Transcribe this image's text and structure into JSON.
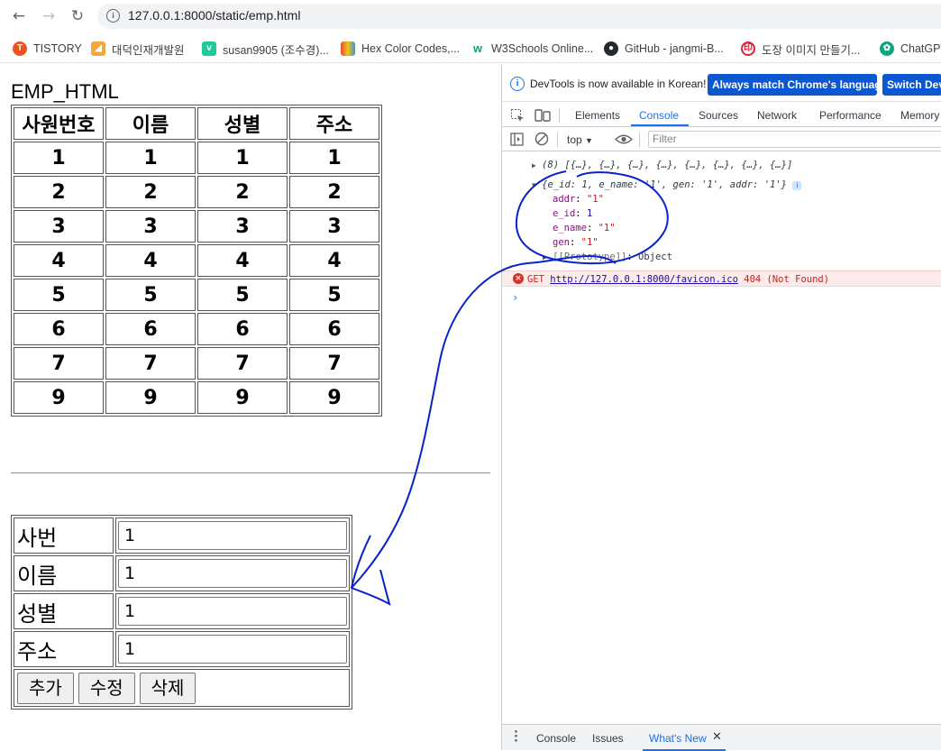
{
  "browser": {
    "url": "127.0.0.1:8000/static/emp.html",
    "nav": {
      "back": "←",
      "forward": "→",
      "reload": "↻"
    },
    "bookmarks": [
      {
        "label": "TISTORY",
        "icon": "tistory-icon",
        "color": "#eb531f"
      },
      {
        "label": "대덕인재개발원",
        "icon": "ddit-icon",
        "color": "#f4a83a"
      },
      {
        "label": "susan9905 (조수경)...",
        "icon": "velog-icon",
        "color": "#20c997"
      },
      {
        "label": "Hex Color Codes,...",
        "icon": "hexcolor-icon",
        "color": "#5b6ee1"
      },
      {
        "label": "W3Schools Online...",
        "icon": "w3schools-icon",
        "color": "#04aa6d"
      },
      {
        "label": "GitHub - jangmi-B...",
        "icon": "github-icon",
        "color": "#24292f"
      },
      {
        "label": "도장 이미지 만들기...",
        "icon": "stamp-icon",
        "color": "#d7263d"
      },
      {
        "label": "ChatGPT",
        "icon": "chatgpt-icon",
        "color": "#10a37f"
      }
    ]
  },
  "page": {
    "title": "EMP_HTML",
    "table": {
      "headers": [
        "사원번호",
        "이름",
        "성별",
        "주소"
      ],
      "rows": [
        [
          "1",
          "1",
          "1",
          "1"
        ],
        [
          "2",
          "2",
          "2",
          "2"
        ],
        [
          "3",
          "3",
          "3",
          "3"
        ],
        [
          "4",
          "4",
          "4",
          "4"
        ],
        [
          "5",
          "5",
          "5",
          "5"
        ],
        [
          "6",
          "6",
          "6",
          "6"
        ],
        [
          "7",
          "7",
          "7",
          "7"
        ],
        [
          "9",
          "9",
          "9",
          "9"
        ]
      ]
    },
    "form": {
      "fields": [
        {
          "label": "사번",
          "value": "1"
        },
        {
          "label": "이름",
          "value": "1"
        },
        {
          "label": "성별",
          "value": "1"
        },
        {
          "label": "주소",
          "value": "1"
        }
      ],
      "buttons": [
        "추가",
        "수정",
        "삭제"
      ]
    }
  },
  "devtools": {
    "info": "DevTools is now available in Korean!",
    "btn_match": "Always match Chrome's language",
    "btn_switch": "Switch DevTools to Korean",
    "tabs": [
      "Elements",
      "Console",
      "Sources",
      "Network",
      "Performance",
      "Memory"
    ],
    "active_tab": "Console",
    "context": "top",
    "filter_placeholder": "Filter",
    "console": {
      "array_line": "(8) [{…}, {…}, {…}, {…}, {…}, {…}, {…}, {…}]",
      "object_line": "{e_id: 1, e_name: '1', gen: '1', addr: '1'}",
      "props": [
        {
          "key": "addr",
          "value": "\"1\"",
          "kind": "str"
        },
        {
          "key": "e_id",
          "value": "1",
          "kind": "num"
        },
        {
          "key": "e_name",
          "value": "\"1\"",
          "kind": "str"
        },
        {
          "key": "gen",
          "value": "\"1\"",
          "kind": "str"
        }
      ],
      "proto_key": "[[Prototype]]",
      "proto_val": "Object",
      "error_method": "GET",
      "error_url": "http://127.0.0.1:8000/favicon.ico",
      "error_status": "404 (Not Found)"
    },
    "drawer_tabs": [
      "Console",
      "Issues",
      "What's New"
    ]
  }
}
